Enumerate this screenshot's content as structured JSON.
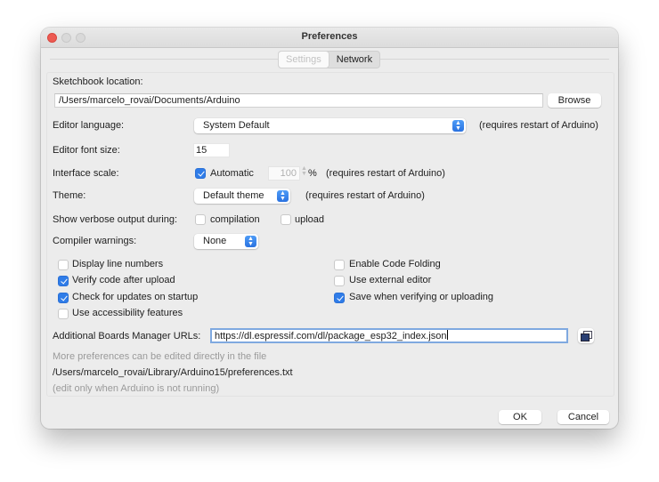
{
  "window": {
    "title": "Preferences"
  },
  "tabs": [
    {
      "label": "Settings",
      "selected": true
    },
    {
      "label": "Network",
      "selected": false
    }
  ],
  "settings": {
    "sketchbook": {
      "label": "Sketchbook location:",
      "value": "/Users/marcelo_rovai/Documents/Arduino",
      "browse_label": "Browse"
    },
    "editor_language": {
      "label": "Editor language:",
      "value": "System Default",
      "note": "(requires restart of Arduino)"
    },
    "editor_font_size": {
      "label": "Editor font size:",
      "value": "15"
    },
    "interface_scale": {
      "label": "Interface scale:",
      "automatic_label": "Automatic",
      "automatic_checked": true,
      "value": "100",
      "unit": "%",
      "note": "(requires restart of Arduino)"
    },
    "theme": {
      "label": "Theme:",
      "value": "Default theme",
      "note": "(requires restart of Arduino)"
    },
    "verbose": {
      "label": "Show verbose output during:",
      "compilation_label": "compilation",
      "compilation_checked": false,
      "upload_label": "upload",
      "upload_checked": false
    },
    "compiler_warnings": {
      "label": "Compiler warnings:",
      "value": "None"
    },
    "options_left": [
      {
        "label": "Display line numbers",
        "checked": false
      },
      {
        "label": "Verify code after upload",
        "checked": true
      },
      {
        "label": "Check for updates on startup",
        "checked": true
      },
      {
        "label": "Use accessibility features",
        "checked": false
      }
    ],
    "options_right": [
      {
        "label": "Enable Code Folding",
        "checked": false
      },
      {
        "label": "Use external editor",
        "checked": false
      },
      {
        "label": "Save when verifying or uploading",
        "checked": true
      }
    ],
    "boards_urls": {
      "label": "Additional Boards Manager URLs:",
      "value": "https://dl.espressif.com/dl/package_esp32_index.json"
    },
    "footer_notes": {
      "more_prefs": "More preferences can be edited directly in the file",
      "prefs_path": "/Users/marcelo_rovai/Library/Arduino15/preferences.txt",
      "edit_note": "(edit only when Arduino is not running)"
    }
  },
  "buttons": {
    "ok": "OK",
    "cancel": "Cancel"
  }
}
